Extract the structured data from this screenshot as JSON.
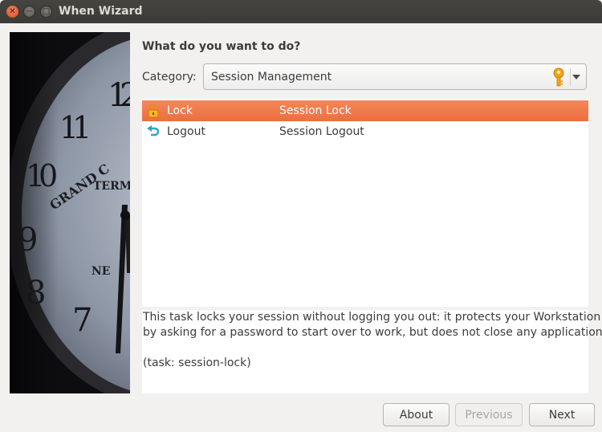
{
  "window": {
    "title": "When Wizard",
    "controls": {
      "close_icon": "close-icon",
      "minimize_icon": "minimize-icon",
      "maximize_icon": "maximize-icon"
    }
  },
  "side_image": {
    "icon": "clock-photo",
    "clock_text": [
      "GRAND C",
      "TERMI",
      "NE"
    ],
    "numerals": [
      "12",
      "11",
      "10",
      "9",
      "8",
      "7"
    ]
  },
  "main": {
    "heading": "What do you want to do?",
    "category_label": "Category:",
    "category_value": "Session Management",
    "category_icon": "key-icon",
    "tasks": [
      {
        "icon": "lock-icon",
        "name": "Lock",
        "description": "Session Lock",
        "selected": true
      },
      {
        "icon": "logout-icon",
        "name": "Logout",
        "description": "Session Logout",
        "selected": false
      }
    ],
    "details": {
      "line1": "This task locks your session without logging you out: it protects your Workstation",
      "line2": "by asking for a password to start over to work, but does not close any application.",
      "line3": "(task: session-lock)"
    }
  },
  "buttons": {
    "about": "About",
    "previous": "Previous",
    "next": "Next"
  },
  "colors": {
    "selection": "#f0773f",
    "titlebar": "#3c3b37",
    "close_button": "#df4a16"
  }
}
